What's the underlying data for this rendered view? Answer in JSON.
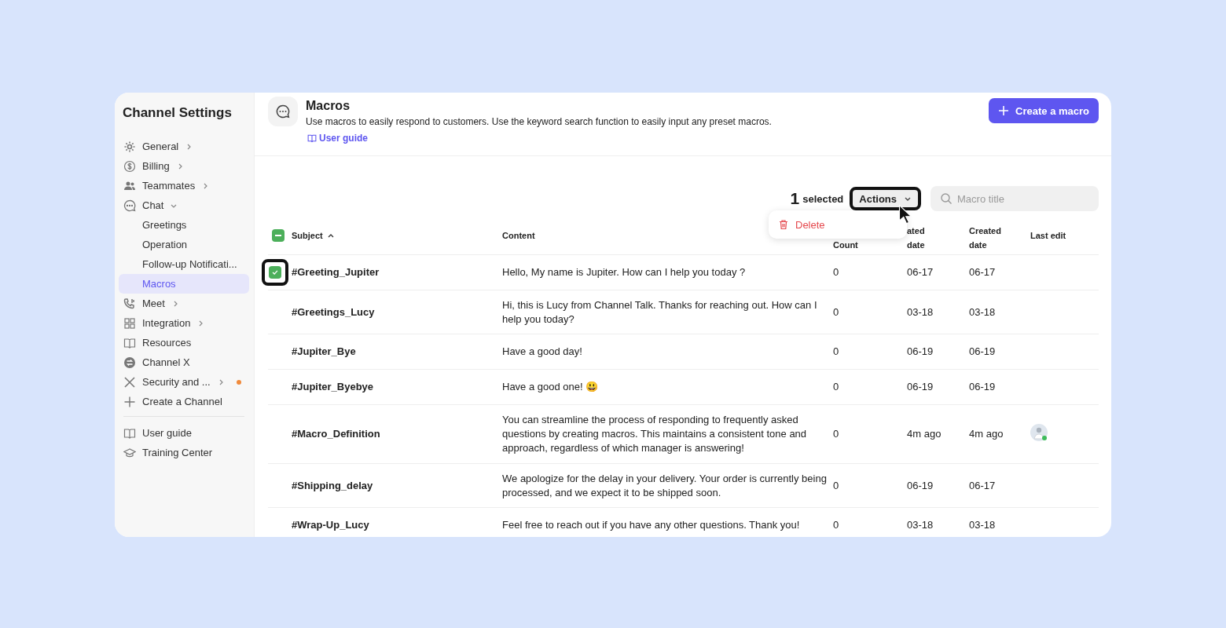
{
  "sidebar": {
    "title": "Channel Settings",
    "items": [
      {
        "label": "General",
        "expanded": false,
        "selected": false
      },
      {
        "label": "Billing",
        "expanded": false,
        "selected": false
      },
      {
        "label": "Teammates",
        "expanded": false,
        "selected": false
      },
      {
        "label": "Chat",
        "expanded": true,
        "selected": false,
        "children": [
          {
            "label": "Greetings",
            "selected": false
          },
          {
            "label": "Operation",
            "selected": false
          },
          {
            "label": "Follow-up Notificati...",
            "selected": false
          },
          {
            "label": "Macros",
            "selected": true
          }
        ]
      },
      {
        "label": "Meet",
        "expanded": false,
        "selected": false
      },
      {
        "label": "Integration",
        "expanded": false,
        "selected": false
      },
      {
        "label": "Resources",
        "selected": false
      },
      {
        "label": "Channel X",
        "selected": false
      },
      {
        "label": "Security and ...",
        "expanded": false,
        "selected": false,
        "alert": true
      },
      {
        "label": "Create a Channel",
        "selected": false
      }
    ],
    "footer_items": [
      {
        "label": "User guide"
      },
      {
        "label": "Training Center"
      }
    ]
  },
  "header": {
    "title": "Macros",
    "description": "Use macros to easily respond to customers. Use the keyword search function to easily input any preset macros.",
    "link": "User guide",
    "button": "Create a macro"
  },
  "toolbar": {
    "count": "1",
    "count_label": "selected",
    "actions": "Actions",
    "search": {
      "placeholder": "Macro title"
    }
  },
  "menu": {
    "items": [
      {
        "label": "Delete",
        "kind": "danger"
      }
    ]
  },
  "table": {
    "select_all": {
      "mixed": true
    },
    "columns": [
      {
        "label": "Subject",
        "sorted": true
      },
      {
        "label": "Content"
      },
      {
        "label": "Count"
      },
      {
        "label": "ated\ndate"
      },
      {
        "label": "Created\ndate"
      },
      {
        "label": "Last edit"
      }
    ],
    "rows": [
      {
        "checked": true,
        "cells": [
          "#Greeting_Jupiter",
          "Hello, My name is Jupiter. How can I help you today ?",
          "0",
          "06-17",
          "06-17"
        ]
      },
      {
        "checked": false,
        "cells": [
          "#Greetings_Lucy",
          "Hi, this is Lucy from Channel Talk. Thanks for reaching out. How can I help you today?",
          "0",
          "03-18",
          "03-18"
        ]
      },
      {
        "checked": false,
        "cells": [
          "#Jupiter_Bye",
          "Have a good day!",
          "0",
          "06-19",
          "06-19"
        ]
      },
      {
        "checked": false,
        "cells": [
          "#Jupiter_Byebye",
          "Have a good one! 😃",
          "0",
          "06-19",
          "06-19"
        ]
      },
      {
        "checked": false,
        "avatar": true,
        "cells": [
          "#Macro_Definition",
          "You can streamline the process of responding to frequently asked questions by creating macros. This maintains a consistent tone and approach, regardless of which manager is answering!",
          "0",
          "4m ago",
          "4m ago"
        ]
      },
      {
        "checked": false,
        "cells": [
          "#Shipping_delay",
          "We apologize for the delay in your delivery. Your order is currently being processed, and we expect it to be shipped soon.",
          "0",
          "06-19",
          "06-17"
        ]
      },
      {
        "checked": false,
        "cells": [
          "#Wrap-Up_Lucy",
          "Feel free to reach out if you have any other questions. Thank you!",
          "0",
          "03-18",
          "03-18"
        ]
      }
    ]
  }
}
